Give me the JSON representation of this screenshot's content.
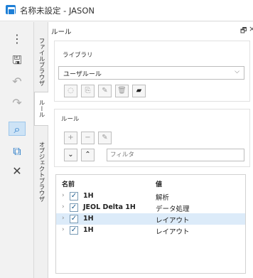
{
  "window": {
    "title": "名称未設定 - JASON"
  },
  "iconbar": {
    "icons": [
      {
        "name": "more-icon",
        "glyph": "⋮"
      },
      {
        "name": "save-icon",
        "glyph": "🖫"
      },
      {
        "name": "undo-icon",
        "glyph": "↶"
      },
      {
        "name": "redo-icon",
        "glyph": "↷"
      },
      {
        "name": "zoom-icon",
        "glyph": "⌕"
      },
      {
        "name": "select-zoom-icon",
        "glyph": "⧉"
      },
      {
        "name": "tools-icon",
        "glyph": "✕"
      }
    ]
  },
  "tabs": [
    "ファイルブラウザ",
    "ルール",
    "オブジェクトブラウザ"
  ],
  "panel": {
    "title": "ルール",
    "pin": "🗗",
    "close": "×",
    "library": {
      "label": "ライブラリ",
      "selected": "ユーザルール",
      "buttons": [
        {
          "name": "new-library-button",
          "glyph": "◌"
        },
        {
          "name": "copy-library-button",
          "glyph": "⎘"
        },
        {
          "name": "edit-library-button",
          "glyph": "✎"
        },
        {
          "name": "delete-library-button",
          "glyph": "🗑"
        },
        {
          "name": "folder-library-button",
          "glyph": "▰"
        }
      ]
    },
    "rules": {
      "label": "ルール",
      "buttons": [
        {
          "name": "add-rule-button",
          "glyph": "+"
        },
        {
          "name": "remove-rule-button",
          "glyph": "−"
        },
        {
          "name": "edit-rule-button",
          "glyph": "✎"
        }
      ],
      "move_down": "⌄",
      "move_up": "⌃",
      "filter_placeholder": "フィルタ"
    },
    "list": {
      "col_name": "名前",
      "col_value": "値",
      "rows": [
        {
          "name": "1H",
          "value": "解析",
          "checked": true
        },
        {
          "name": "JEOL Delta 1H",
          "value": "データ処理",
          "checked": true
        },
        {
          "name": "1H",
          "value": "レイアウト",
          "checked": true,
          "selected": true
        },
        {
          "name": "1H",
          "value": "レイアウト",
          "checked": true
        }
      ]
    }
  }
}
